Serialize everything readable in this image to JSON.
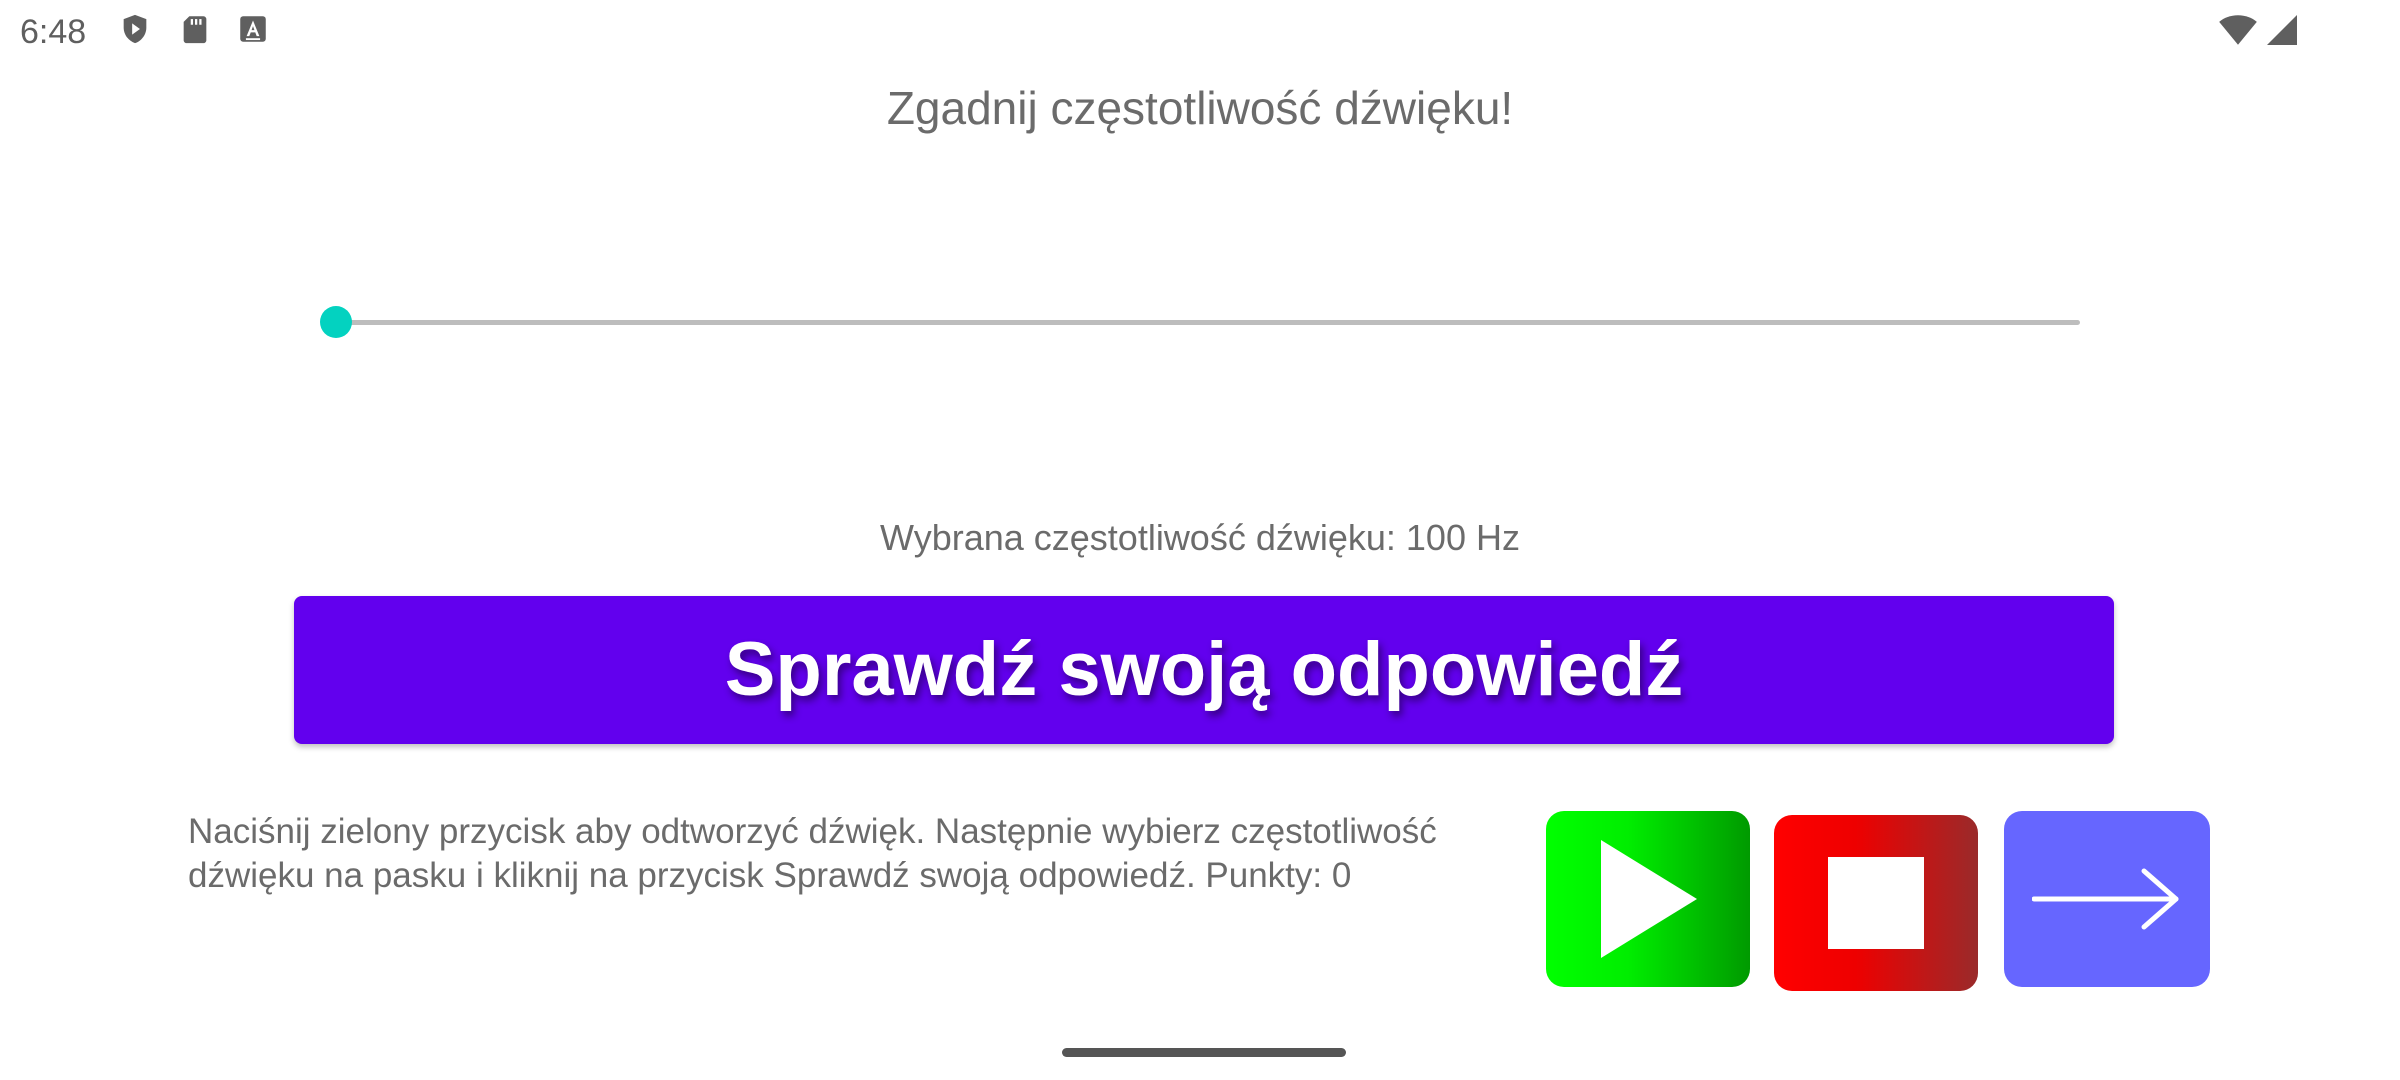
{
  "status_bar": {
    "time": "6:48",
    "left_icons": [
      "shield-play-icon",
      "sd-card-icon",
      "keyboard-a-icon"
    ],
    "right_icons": [
      "wifi-icon",
      "signal-icon"
    ]
  },
  "title": "Zgadnij częstotliwość dźwięku!",
  "slider": {
    "value_fraction": 0.0,
    "accent_color": "#03dac5"
  },
  "frequency_label": "Wybrana częstotliwość dźwięku: 100 Hz",
  "check_button": {
    "label": "Sprawdź swoją odpowiedź",
    "color": "#6200ee"
  },
  "instructions": "Naciśnij zielony przycisk aby odtworzyć dźwięk. Następnie wybierz częstotliwość dźwięku na pasku i kliknij na przycisk Sprawdź swoją odpowiedź. Punkty: 0",
  "controls": {
    "play": {
      "icon": "play-icon",
      "color": "#00ff00"
    },
    "stop": {
      "icon": "stop-icon",
      "color": "#ff0000"
    },
    "next": {
      "icon": "arrow-right-icon",
      "color": "#6666ff"
    }
  }
}
